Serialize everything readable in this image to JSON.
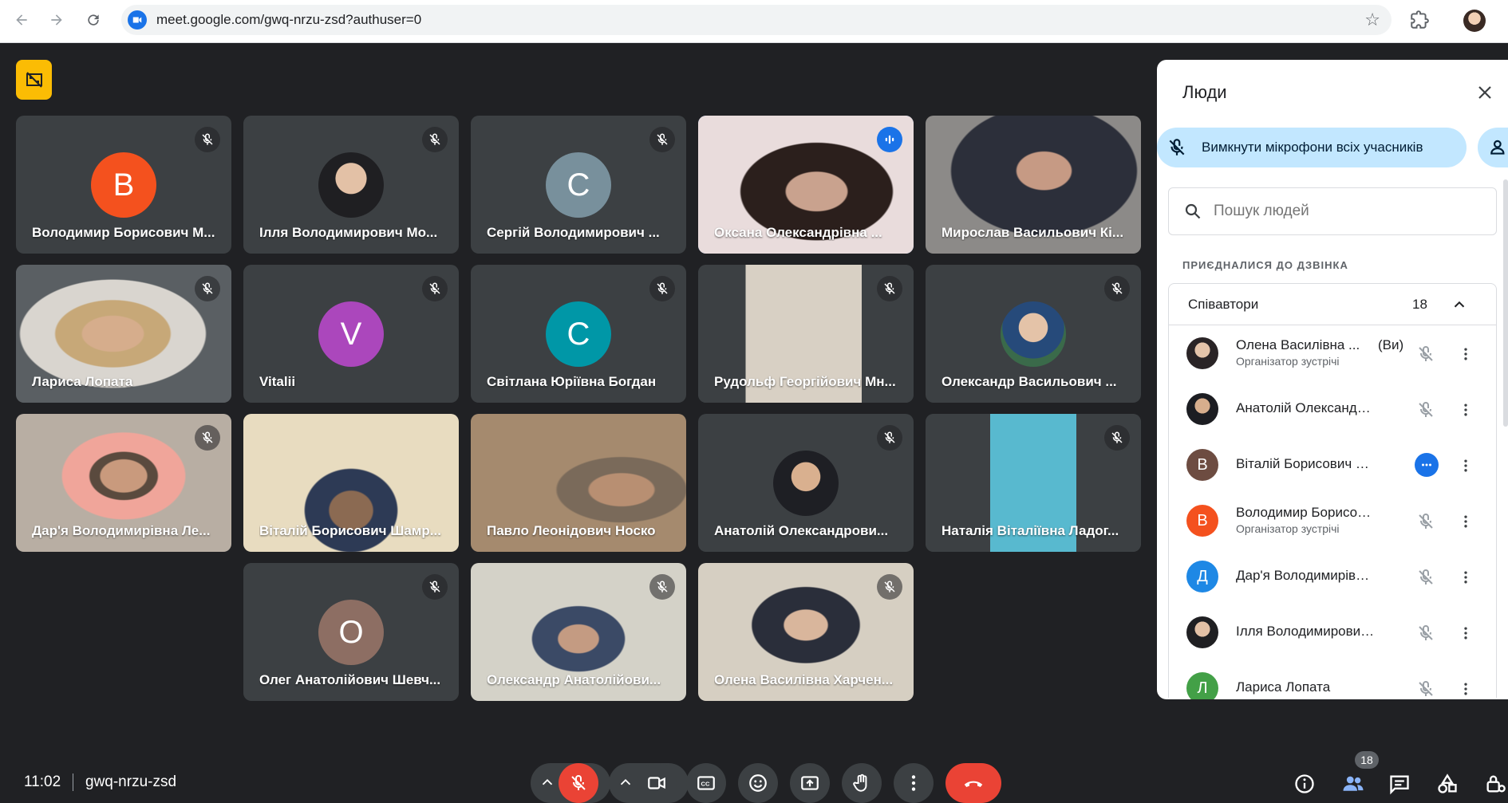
{
  "browser": {
    "url": "meet.google.com/gwq-nrzu-zsd?authuser=0"
  },
  "meeting": {
    "time": "11:02",
    "code": "gwq-nrzu-zsd",
    "participant_count": "18"
  },
  "tiles": [
    {
      "name": "Володимир Борисович М...",
      "kind": "letter",
      "letter": "В",
      "color": "#f4511e",
      "muted": true
    },
    {
      "name": "Ілля Володимирович Мо...",
      "kind": "photo",
      "muted": true
    },
    {
      "name": "Сергій Володимирович ...",
      "kind": "letter",
      "letter": "С",
      "color": "#78909c",
      "muted": true
    },
    {
      "name": "Оксана Олександрівна ...",
      "kind": "video",
      "muted": false,
      "speaking": true
    },
    {
      "name": "Мирослав Васильович Кі...",
      "kind": "video",
      "muted": false
    },
    {
      "name": "Лариса Лопата",
      "kind": "video",
      "muted": true
    },
    {
      "name": "Vitalii",
      "kind": "letter",
      "letter": "V",
      "color": "#ab47bc",
      "muted": true
    },
    {
      "name": "Світлана Юріївна Богдан",
      "kind": "letter",
      "letter": "С",
      "color": "#0097a7",
      "muted": true
    },
    {
      "name": "Рудольф Георгійович Мн...",
      "kind": "video",
      "muted": true
    },
    {
      "name": "Олександр Васильович ...",
      "kind": "photo",
      "muted": true
    },
    {
      "name": "Дар'я Володимирівна Ле...",
      "kind": "video",
      "muted": true
    },
    {
      "name": "Віталій Борисович Шамр...",
      "kind": "video",
      "muted": false
    },
    {
      "name": "Павло Леонідович Носко",
      "kind": "video",
      "muted": false
    },
    {
      "name": "Анатолій Олександрови...",
      "kind": "photo",
      "muted": true
    },
    {
      "name": "Наталія Віталіївна Ладог...",
      "kind": "video",
      "muted": true
    },
    {
      "name": "Олег Анатолійович Шевч...",
      "kind": "letter",
      "letter": "О",
      "color": "#8d6e63",
      "muted": true
    },
    {
      "name": "Олександр Анатолійови...",
      "kind": "video",
      "muted": true
    },
    {
      "name": "Олена Василівна Харчен...",
      "kind": "video",
      "muted": true
    }
  ],
  "panel": {
    "title": "Люди",
    "mute_all_label": "Вимкнути мікрофони всіх учасників",
    "search_placeholder": "Пошук людей",
    "section_label": "ПРИЄДНАЛИСЯ ДО ДЗВІНКА",
    "group_name": "Співавтори",
    "group_count": "18",
    "people": [
      {
        "name": "Олена Василівна ...",
        "you": "(Ви)",
        "role": "Організатор зустрічі",
        "avatar": "photo",
        "color": "#5d4037",
        "state": "muted"
      },
      {
        "name": "Анатолій Олександров...",
        "role": "",
        "avatar": "photo",
        "color": "#3e2723",
        "state": "muted"
      },
      {
        "name": "Віталій Борисович Ша...",
        "role": "",
        "avatar": "letter",
        "letter": "В",
        "color": "#6d4c41",
        "state": "active"
      },
      {
        "name": "Володимир Борисович...",
        "role": "Організатор зустрічі",
        "avatar": "letter",
        "letter": "В",
        "color": "#f4511e",
        "state": "muted"
      },
      {
        "name": "Дар'я Володимирівна ...",
        "role": "",
        "avatar": "letter",
        "letter": "Д",
        "color": "#1e88e5",
        "state": "muted"
      },
      {
        "name": "Ілля Володимирович М...",
        "role": "",
        "avatar": "photo",
        "color": "#a1887f",
        "state": "muted"
      },
      {
        "name": "Лариса Лопата",
        "role": "",
        "avatar": "letter",
        "letter": "Л",
        "color": "#43a047",
        "state": "muted"
      }
    ]
  },
  "colors": {
    "accent": "#1a73e8",
    "leave": "#ea4335",
    "tile_bg": "#3c4043",
    "stage_bg": "#202124",
    "mute_all_bg": "#c2e7ff"
  }
}
